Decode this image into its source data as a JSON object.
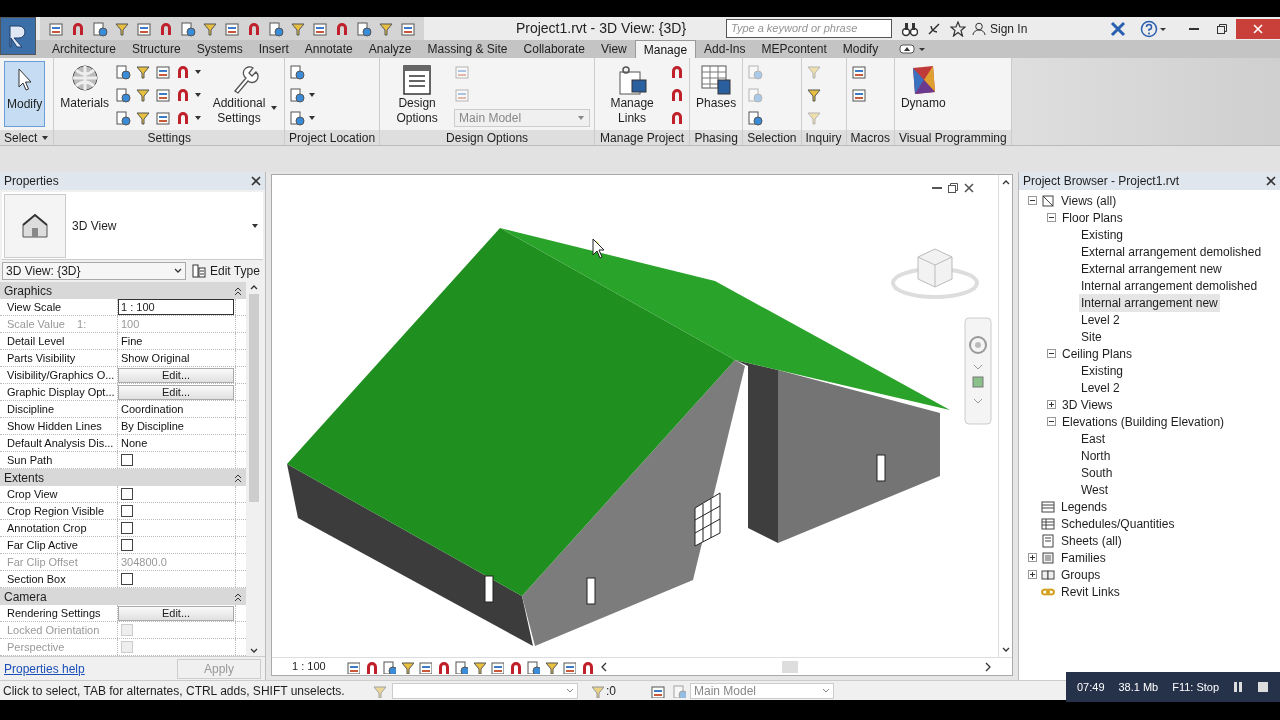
{
  "window": {
    "title": "Project1.rvt - 3D View: {3D}"
  },
  "search": {
    "placeholder": "Type a keyword or phrase"
  },
  "sign_in": "Sign In",
  "tabs": [
    {
      "label": "Architecture",
      "selected": false
    },
    {
      "label": "Structure",
      "selected": false
    },
    {
      "label": "Systems",
      "selected": false
    },
    {
      "label": "Insert",
      "selected": false
    },
    {
      "label": "Annotate",
      "selected": false
    },
    {
      "label": "Analyze",
      "selected": false
    },
    {
      "label": "Massing & Site",
      "selected": false
    },
    {
      "label": "Collaborate",
      "selected": false
    },
    {
      "label": "View",
      "selected": false
    },
    {
      "label": "Manage",
      "selected": true
    },
    {
      "label": "Add-Ins",
      "selected": false
    },
    {
      "label": "MEPcontent",
      "selected": false
    },
    {
      "label": "Modify",
      "selected": false
    }
  ],
  "ribbon_panels": [
    {
      "title": "Select",
      "dropdown": true,
      "tools": [
        {
          "kind": "large",
          "label": "Modify",
          "selected": true,
          "dropdown": false
        }
      ]
    },
    {
      "title": "Settings",
      "dropdown": false,
      "tools": [
        {
          "kind": "large",
          "label": "Materials",
          "selected": false,
          "dropdown": false
        },
        {
          "kind": "column",
          "items": [
            {
              "kind": "icon",
              "disabled": false,
              "dropdown": false
            },
            {
              "kind": "icon",
              "disabled": false,
              "dropdown": false
            },
            {
              "kind": "icon",
              "disabled": false,
              "dropdown": false
            }
          ]
        },
        {
          "kind": "column",
          "items": [
            {
              "kind": "icon",
              "disabled": false,
              "dropdown": false
            },
            {
              "kind": "icon",
              "disabled": false,
              "dropdown": false
            },
            {
              "kind": "icon",
              "disabled": false,
              "dropdown": false
            }
          ]
        },
        {
          "kind": "column",
          "items": [
            {
              "kind": "icon",
              "disabled": false,
              "dropdown": false
            },
            {
              "kind": "icon",
              "disabled": false,
              "dropdown": false
            },
            {
              "kind": "icon",
              "disabled": false,
              "dropdown": false
            }
          ]
        },
        {
          "kind": "column",
          "items": [
            {
              "kind": "icon",
              "disabled": false,
              "dropdown": true
            },
            {
              "kind": "icon",
              "disabled": false,
              "dropdown": true
            },
            {
              "kind": "icon",
              "disabled": false,
              "dropdown": true
            }
          ]
        },
        {
          "kind": "large",
          "label": "Additional Settings",
          "selected": false,
          "dropdown": true
        }
      ]
    },
    {
      "title": "Project Location",
      "dropdown": false,
      "tools": [
        {
          "kind": "column",
          "items": [
            {
              "kind": "icon",
              "disabled": false,
              "dropdown": false
            },
            {
              "kind": "icon",
              "disabled": false,
              "dropdown": true
            },
            {
              "kind": "icon",
              "disabled": false,
              "dropdown": true
            }
          ]
        }
      ]
    },
    {
      "title": "Design Options",
      "dropdown": false,
      "tools": [
        {
          "kind": "large",
          "label": "Design Options",
          "selected": false,
          "dropdown": false
        },
        {
          "kind": "column",
          "items": [
            {
              "kind": "icon",
              "disabled": true,
              "dropdown": false
            },
            {
              "kind": "icon",
              "disabled": true,
              "dropdown": false
            },
            {
              "kind": "select",
              "value": "Main Model",
              "disabled": true
            }
          ]
        }
      ]
    },
    {
      "title": "Manage Project",
      "dropdown": false,
      "tools": [
        {
          "kind": "large",
          "label": "Manage Links",
          "selected": false,
          "dropdown": false
        },
        {
          "kind": "column",
          "items": [
            {
              "kind": "icon",
              "disabled": false,
              "dropdown": false
            },
            {
              "kind": "icon",
              "disabled": false,
              "dropdown": false
            },
            {
              "kind": "icon",
              "disabled": false,
              "dropdown": false
            }
          ]
        }
      ]
    },
    {
      "title": "Phasing",
      "dropdown": false,
      "tools": [
        {
          "kind": "large",
          "label": "Phases",
          "selected": false,
          "dropdown": false
        }
      ]
    },
    {
      "title": "Selection",
      "dropdown": false,
      "tools": [
        {
          "kind": "column",
          "items": [
            {
              "kind": "icon",
              "disabled": true,
              "dropdown": false
            },
            {
              "kind": "icon",
              "disabled": true,
              "dropdown": false
            },
            {
              "kind": "icon",
              "disabled": false,
              "dropdown": false
            }
          ]
        }
      ]
    },
    {
      "title": "Inquiry",
      "dropdown": false,
      "tools": [
        {
          "kind": "column",
          "items": [
            {
              "kind": "icon",
              "disabled": true,
              "dropdown": false
            },
            {
              "kind": "icon",
              "disabled": false,
              "dropdown": false
            },
            {
              "kind": "icon",
              "disabled": true,
              "dropdown": false
            }
          ]
        }
      ]
    },
    {
      "title": "Macros",
      "dropdown": false,
      "tools": [
        {
          "kind": "column",
          "items": [
            {
              "kind": "icon",
              "disabled": false,
              "dropdown": false
            },
            {
              "kind": "icon",
              "disabled": false,
              "dropdown": false
            }
          ]
        }
      ]
    },
    {
      "title": "Visual Programming",
      "dropdown": false,
      "tools": [
        {
          "kind": "large",
          "label": "Dynamo",
          "selected": false,
          "dropdown": false
        }
      ]
    }
  ],
  "properties": {
    "title": "Properties",
    "type_name": "3D View",
    "instance": "3D View: {3D}",
    "edit_type": "Edit Type",
    "groups": [
      {
        "name": "Graphics",
        "rows": [
          {
            "label": "View Scale",
            "kind": "field",
            "value": "1 : 100",
            "disabled": false
          },
          {
            "label": "Scale Value    1:",
            "kind": "text",
            "value": "100",
            "disabled": true
          },
          {
            "label": "Detail Level",
            "kind": "text",
            "value": "Fine",
            "disabled": false
          },
          {
            "label": "Parts Visibility",
            "kind": "text",
            "value": "Show Original",
            "disabled": false
          },
          {
            "label": "Visibility/Graphics O...",
            "kind": "button",
            "value": "Edit...",
            "disabled": false
          },
          {
            "label": "Graphic Display Opt...",
            "kind": "button",
            "value": "Edit...",
            "disabled": false
          },
          {
            "label": "Discipline",
            "kind": "text",
            "value": "Coordination",
            "disabled": false
          },
          {
            "label": "Show Hidden Lines",
            "kind": "text",
            "value": "By Discipline",
            "disabled": false
          },
          {
            "label": "Default Analysis Dis...",
            "kind": "text",
            "value": "None",
            "disabled": false
          },
          {
            "label": "Sun Path",
            "kind": "checkbox",
            "checked": false,
            "disabled": false
          }
        ]
      },
      {
        "name": "Extents",
        "rows": [
          {
            "label": "Crop View",
            "kind": "checkbox",
            "checked": false,
            "disabled": false
          },
          {
            "label": "Crop Region Visible",
            "kind": "checkbox",
            "checked": false,
            "disabled": false
          },
          {
            "label": "Annotation Crop",
            "kind": "checkbox",
            "checked": false,
            "disabled": false
          },
          {
            "label": "Far Clip Active",
            "kind": "checkbox",
            "checked": false,
            "disabled": false
          },
          {
            "label": "Far Clip Offset",
            "kind": "text",
            "value": "304800.0",
            "disabled": true
          },
          {
            "label": "Section Box",
            "kind": "checkbox",
            "checked": false,
            "disabled": false
          }
        ]
      },
      {
        "name": "Camera",
        "rows": [
          {
            "label": "Rendering Settings",
            "kind": "button",
            "value": "Edit...",
            "disabled": false
          },
          {
            "label": "Locked Orientation",
            "kind": "checkbox",
            "checked": false,
            "disabled": true
          },
          {
            "label": "Perspective",
            "kind": "checkbox",
            "checked": false,
            "disabled": true
          }
        ]
      }
    ],
    "help": "Properties help",
    "apply": {
      "label": "Apply",
      "disabled": true
    }
  },
  "viewport": {
    "scale": "1 : 100"
  },
  "browser": {
    "title": "Project Browser - Project1.rvt",
    "tree": [
      {
        "label": "Views (all)",
        "expanded": true,
        "selected": false,
        "children": [
          {
            "label": "Floor Plans",
            "expanded": true,
            "selected": false,
            "children": [
              {
                "label": "Existing",
                "selected": false
              },
              {
                "label": "External arrangement demolished",
                "selected": false
              },
              {
                "label": "External arrangement new",
                "selected": false
              },
              {
                "label": "Internal arrangement demolished",
                "selected": false
              },
              {
                "label": "Internal arrangement new",
                "selected": true
              },
              {
                "label": "Level 2",
                "selected": false
              },
              {
                "label": "Site",
                "selected": false
              }
            ]
          },
          {
            "label": "Ceiling Plans",
            "expanded": true,
            "selected": false,
            "children": [
              {
                "label": "Existing",
                "selected": false
              },
              {
                "label": "Level 2",
                "selected": false
              }
            ]
          },
          {
            "label": "3D Views",
            "expanded": false,
            "selected": false
          },
          {
            "label": "Elevations (Building Elevation)",
            "expanded": true,
            "selected": false,
            "children": [
              {
                "label": "East",
                "selected": false
              },
              {
                "label": "North",
                "selected": false
              },
              {
                "label": "South",
                "selected": false
              },
              {
                "label": "West",
                "selected": false
              }
            ]
          }
        ]
      },
      {
        "label": "Legends",
        "selected": false
      },
      {
        "label": "Schedules/Quantities",
        "selected": false
      },
      {
        "label": "Sheets (all)",
        "selected": false
      },
      {
        "label": "Families",
        "expanded": false,
        "selected": false
      },
      {
        "label": "Groups",
        "expanded": false,
        "selected": false
      },
      {
        "label": "Revit Links",
        "selected": false
      }
    ]
  },
  "status_bar": {
    "hint": "Click to select, TAB for alternates, CTRL adds, SHIFT unselects.",
    "selection_count": ":0",
    "workset": "Main Model"
  },
  "recorder": {
    "time": "07:49",
    "size": "38.1 Mb",
    "stop": "F11: Stop"
  }
}
